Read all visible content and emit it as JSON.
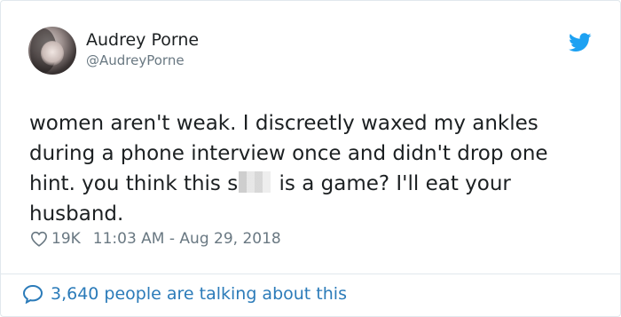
{
  "tweet": {
    "author": {
      "display_name": "Audrey Porne",
      "handle": "@AudreyPorne",
      "avatar_icon": "profile-photo"
    },
    "text_before_censor": "women aren't weak. I discreetly waxed my ankles during a phone interview once and didn't drop one hint. you think this s",
    "text_after_censor": " is a game? I'll eat your husband.",
    "likes": "19K",
    "timestamp": "11:03 AM - Aug 29, 2018",
    "talking_about": "3,640 people are talking about this"
  },
  "icons": {
    "brand": "twitter-bird-icon",
    "like": "heart-icon",
    "conversation": "speech-bubble-icon"
  },
  "colors": {
    "brand_blue": "#1da1f2",
    "link_blue": "#2b7bb9",
    "muted_text": "#697882",
    "body_text": "#1c2022",
    "border": "#e1e8ed"
  }
}
